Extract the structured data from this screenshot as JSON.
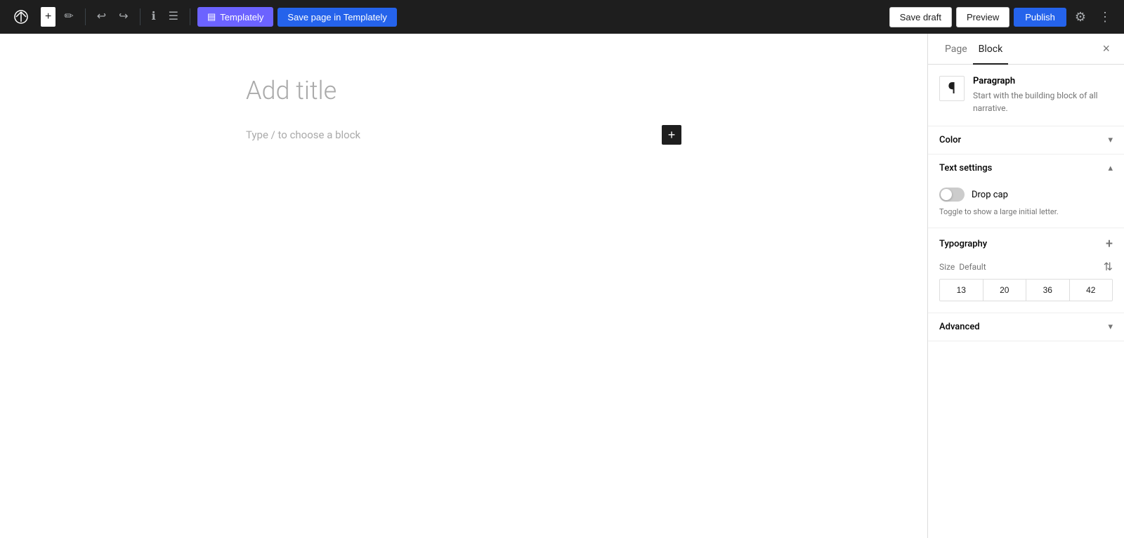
{
  "toolbar": {
    "wp_logo": "W",
    "add_label": "+",
    "tool_label": "✏",
    "undo_label": "↩",
    "redo_label": "↪",
    "info_label": "ℹ",
    "list_label": "☰",
    "templately_btn": "Templately",
    "save_templately_btn": "Save page in Templately",
    "save_draft_btn": "Save draft",
    "preview_btn": "Preview",
    "publish_btn": "Publish",
    "settings_btn": "⚙",
    "more_btn": "⋮"
  },
  "editor": {
    "title_placeholder": "Add title",
    "block_placeholder": "Type / to choose a block"
  },
  "sidebar": {
    "tab_page": "Page",
    "tab_block": "Block",
    "close_btn": "×",
    "block_info": {
      "icon": "¶",
      "title": "Paragraph",
      "description": "Start with the building block of all narrative."
    },
    "color_section": {
      "label": "Color",
      "expanded": false
    },
    "text_settings": {
      "label": "Text settings",
      "expanded": true,
      "drop_cap_label": "Drop cap",
      "drop_cap_desc": "Toggle to show a large initial letter."
    },
    "typography": {
      "label": "Typography",
      "expanded": true,
      "size_label": "Size",
      "size_default": "Default",
      "font_sizes": [
        "13",
        "20",
        "36",
        "42"
      ]
    },
    "advanced": {
      "label": "Advanced",
      "expanded": false
    }
  }
}
